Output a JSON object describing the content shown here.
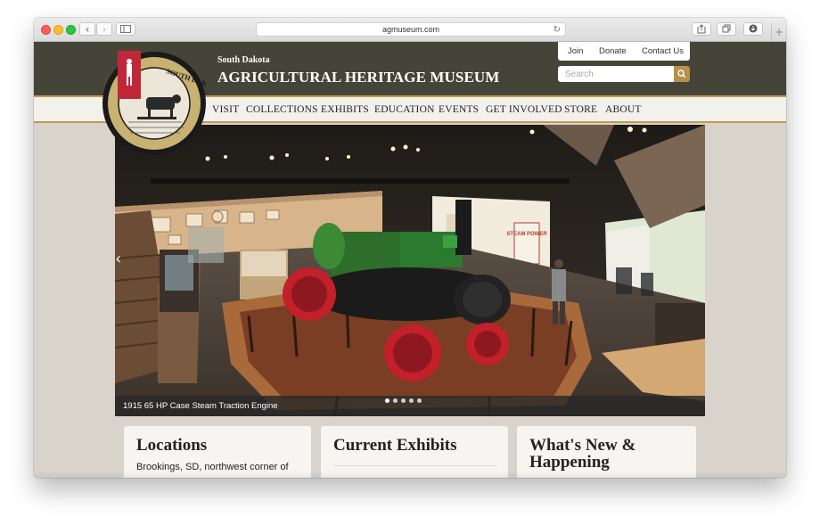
{
  "browser": {
    "url": "agmuseum.com"
  },
  "header": {
    "subtitle": "South Dakota",
    "title": "AGRICULTURAL HERITAGE MUSEUM",
    "logo_text": "SOUTH DAKOTA AGRICULTURAL HERITAGE MUSEUM"
  },
  "util_nav": {
    "join": "Join",
    "donate": "Donate",
    "contact": "Contact Us"
  },
  "search": {
    "placeholder": "Search"
  },
  "nav": {
    "items": [
      "VISIT",
      "COLLECTIONS",
      "EXHIBITS",
      "EDUCATION",
      "EVENTS",
      "GET INVOLVED",
      "STORE",
      "ABOUT"
    ]
  },
  "hero": {
    "caption": "1915 65 HP Case Steam Traction Engine",
    "slides_total": 5,
    "active_slide": 1,
    "sign_text": "STEAM POWER"
  },
  "cards": [
    {
      "title": "Locations",
      "text": "Brookings, SD, northwest corner of"
    },
    {
      "title": "Current Exhibits",
      "text": ""
    },
    {
      "title": "What's New & Happening",
      "text": ""
    }
  ]
}
